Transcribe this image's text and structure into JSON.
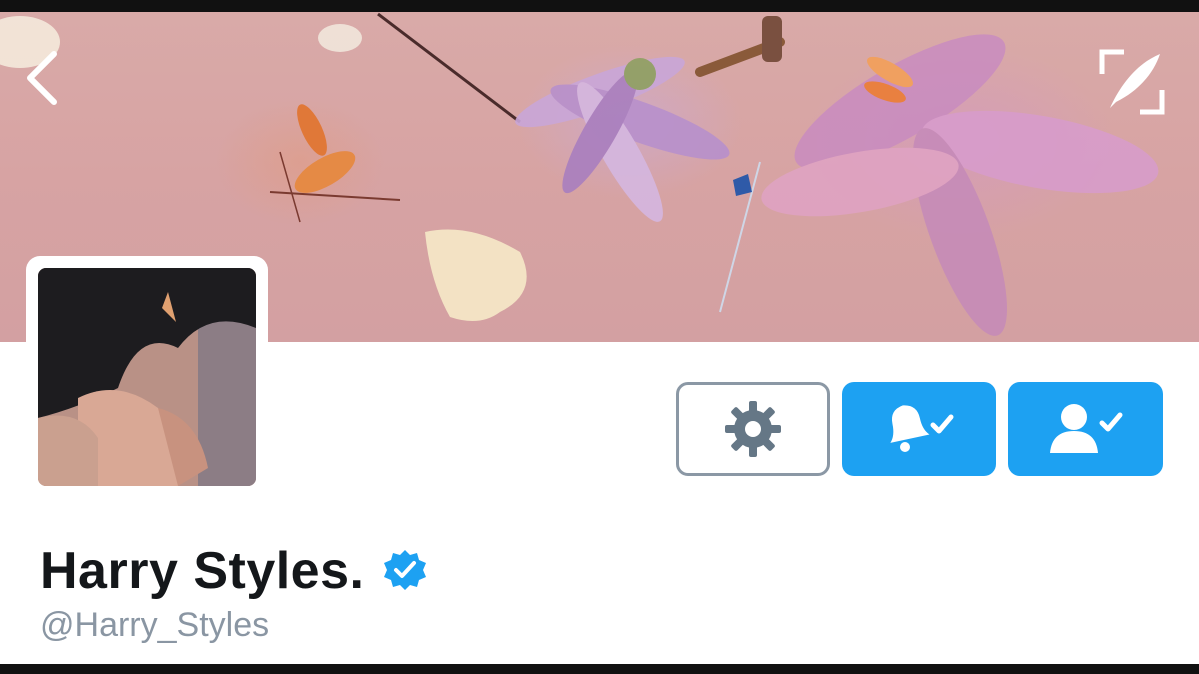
{
  "profile": {
    "display_name": "Harry Styles.",
    "handle": "@Harry_Styles",
    "verified": true
  },
  "header": {
    "back_icon": "chevron-left-icon",
    "compose_icon": "quill-expand-icon"
  },
  "actions": [
    {
      "name": "settings",
      "icon": "gear-icon"
    },
    {
      "name": "notifications",
      "icon": "bell-check-icon"
    },
    {
      "name": "following",
      "icon": "user-check-icon"
    }
  ],
  "colors": {
    "accent": "#1da1f2",
    "name_text": "#14171a",
    "handle_text": "#8a96a3",
    "settings_border": "#8b98a5",
    "banner": "#d7a3a3"
  }
}
